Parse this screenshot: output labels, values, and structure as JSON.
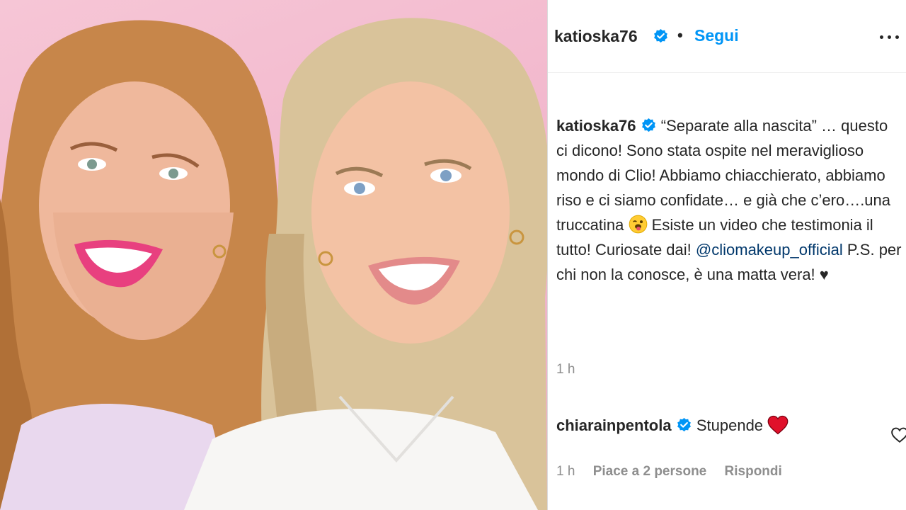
{
  "post": {
    "author": "katioska76",
    "follow_label": "Segui",
    "separator": "•",
    "caption": {
      "author": "katioska76",
      "text_part1": "“Separate alla nascita” … questo ci dicono! Sono stata ospite nel meraviglioso mondo di Clio! Abbiamo chiacchierato, abbiamo riso e ci siamo confidate… e già che c’ero….una truccatina",
      "text_part2": "Esiste un video che testimonia il tutto! Curiosate dai!",
      "mention": "@cliomakeup_official",
      "text_part3": "P.S. per chi non la conosce, è una matta vera! ♥",
      "emoji": "tongue-wink-emoji"
    },
    "time": "1 h"
  },
  "comment": {
    "author": "chiarainpentola",
    "text": "Stupende",
    "emoji": "red-heart-emoji",
    "time": "1 h",
    "likes": "Piace a 2 persone",
    "reply_label": "Rispondi"
  },
  "colors": {
    "accent": "#0095f6",
    "verified": "#0095f6",
    "mention": "#00376b",
    "muted": "#8e8e8e",
    "background_photo": "#f2b8cd"
  }
}
